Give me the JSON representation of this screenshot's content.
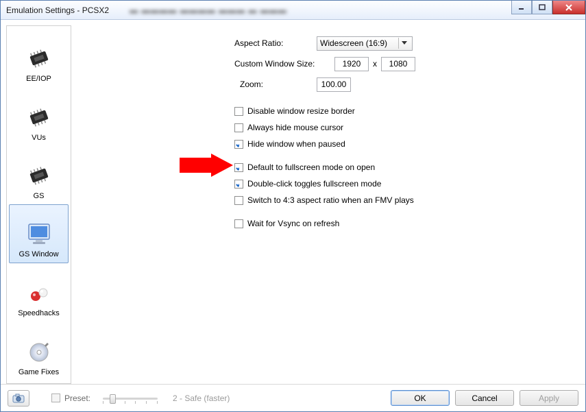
{
  "window": {
    "title": "Emulation Settings - PCSX2"
  },
  "sidebar": {
    "items": [
      {
        "label": "EE/IOP"
      },
      {
        "label": "VUs"
      },
      {
        "label": "GS"
      },
      {
        "label": "GS Window"
      },
      {
        "label": "Speedhacks"
      },
      {
        "label": "Game Fixes"
      }
    ],
    "selected_index": 3
  },
  "pane": {
    "aspect_ratio_label": "Aspect Ratio:",
    "aspect_ratio_value": "Widescreen (16:9)",
    "custom_size_label": "Custom Window Size:",
    "custom_size_w": "1920",
    "custom_size_h": "1080",
    "zoom_label": "Zoom:",
    "zoom_value": "100.00",
    "checks": {
      "disable_resize": {
        "label": "Disable window resize border",
        "checked": false
      },
      "hide_cursor": {
        "label": "Always hide mouse cursor",
        "checked": false
      },
      "hide_paused": {
        "label": "Hide window when paused",
        "checked": true
      },
      "default_fs": {
        "label": "Default to fullscreen mode on open",
        "checked": true
      },
      "dblclick_fs": {
        "label": "Double-click toggles fullscreen mode",
        "checked": true
      },
      "switch_43": {
        "label": "Switch to 4:3 aspect ratio when an FMV plays",
        "checked": false
      },
      "vsync": {
        "label": "Wait for Vsync on refresh",
        "checked": false
      }
    }
  },
  "bottombar": {
    "preset_label": "Preset:",
    "preset_value_label": "2 - Safe (faster)",
    "ok": "OK",
    "cancel": "Cancel",
    "apply": "Apply"
  }
}
